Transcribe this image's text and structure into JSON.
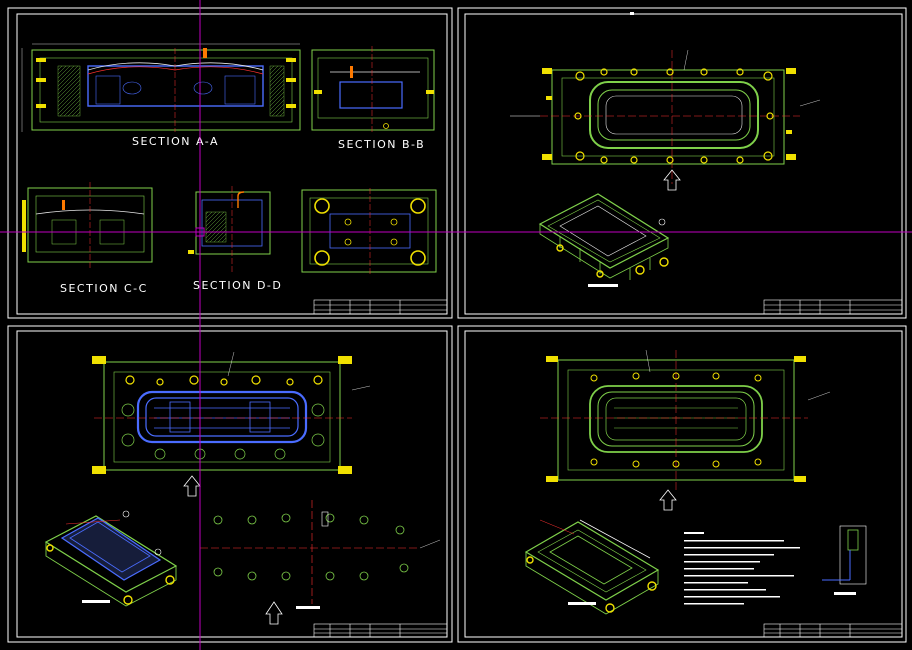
{
  "colors": {
    "background": "#000000",
    "frame": "#ffffff",
    "die_green": "#7fd04a",
    "outline_white": "#e8e8e8",
    "part_blue": "#4a6cff",
    "hole_yellow": "#f0e000",
    "centerline_red": "#ff3030",
    "crosshair_magenta": "#c000c0",
    "accent_orange": "#ff7a00"
  },
  "sheets": {
    "top_left": {
      "labels": [
        "SECTION  A-A",
        "SECTION  B-B",
        "SECTION  C-C",
        "SECTION  D-D"
      ]
    }
  },
  "icons": {
    "crosshair": "crosshair-cursor-icon"
  }
}
